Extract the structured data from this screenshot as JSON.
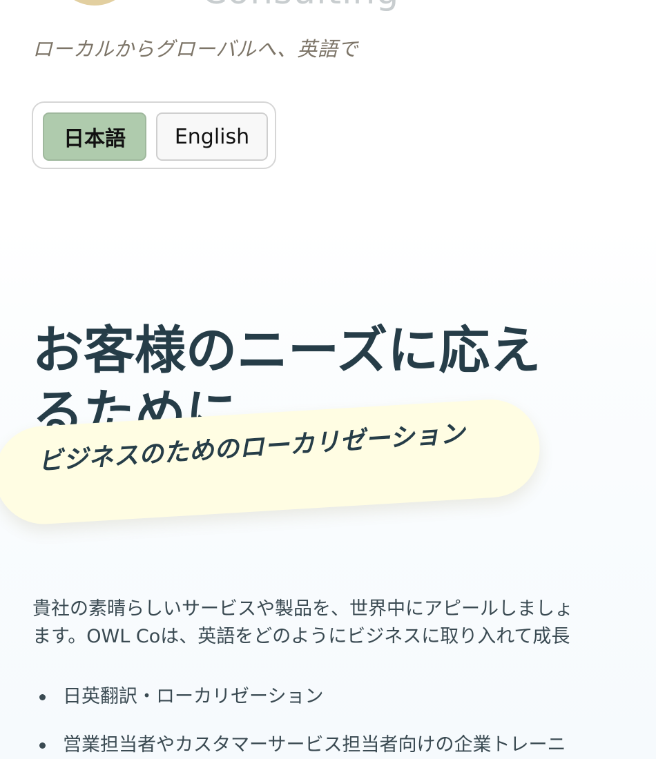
{
  "header": {
    "logo_text": "Consulting",
    "tagline": "ローカルからグローバルへ、英語で"
  },
  "language_switch": {
    "options": [
      {
        "label": "日本語",
        "selected": true
      },
      {
        "label": "English",
        "selected": false
      }
    ]
  },
  "hero": {
    "title_line1": "お客様のニーズに応え",
    "title_line2": "るために",
    "highlight": "ビジネスのためのローカリゼーション"
  },
  "intro": {
    "line1": "貴社の素晴らしいサービスや製品を、世界中にアピールしましょ",
    "line2": "ます。OWL Coは、英語をどのようにビジネスに取り入れて成長"
  },
  "features": [
    {
      "label": "日英翻訳・ローカリゼーション"
    },
    {
      "label": "営業担当者やカスタマーサービス担当者向けの企業トレーニ"
    }
  ],
  "colors": {
    "selected_button": "#afcbad",
    "highlight_band": "#fffde3",
    "heading": "#263d48",
    "tagline": "#7d7568"
  }
}
